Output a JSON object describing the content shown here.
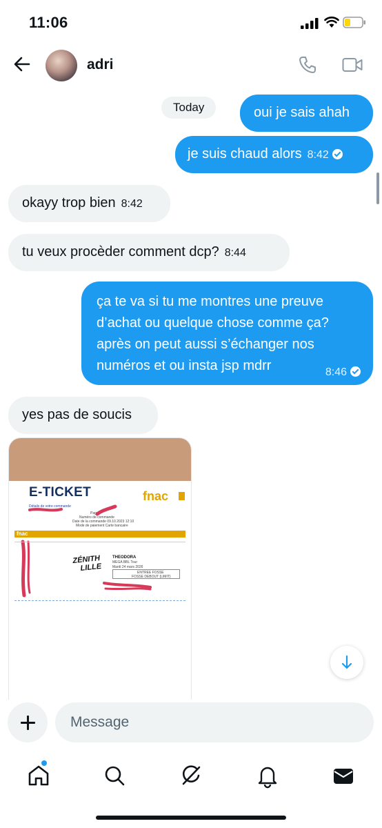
{
  "status_bar": {
    "time": "11:06"
  },
  "header": {
    "contact_name": "adri"
  },
  "chat": {
    "date_label": "Today",
    "messages": [
      {
        "text": "oui je sais ahah",
        "time": ""
      },
      {
        "text": "je suis chaud alors",
        "time": "8:42"
      },
      {
        "text": "okayy trop bien",
        "time": "8:42"
      },
      {
        "text": "tu veux procèder comment dcp?",
        "time": "8:44"
      },
      {
        "lines": [
          "ça te va si tu me montres une preuve",
          "d’achat ou quelque chose comme ça?",
          "après on peut aussi s’échanger nos",
          "numéros et ou insta jsp mdrr"
        ],
        "time": "8:46"
      },
      {
        "text": "yes pas de soucis",
        "time": ""
      }
    ],
    "attachment": {
      "title": "E-TICKET",
      "brand": "fnac",
      "venue": [
        "ZÉNITH",
        "LILLE"
      ],
      "details": [
        "Détails de votre commande",
        "Page",
        "Numéro de commande",
        "Date de la commande  09.10.2023 12:10",
        "Mode de paiement  Carte bancaire"
      ],
      "event": [
        "THEODORA",
        "MEGA BBL Tour",
        "Mardi 24 mars 2026",
        "ENTREE FOSSE",
        "FOSSE DEBOUT (LIMIT)"
      ]
    }
  },
  "composer": {
    "placeholder": "Message"
  },
  "tabs": [
    "home",
    "search",
    "grok",
    "notifications",
    "messages"
  ],
  "colors": {
    "accent": "#1d9bf0",
    "incoming_bubble": "#eff3f4",
    "fnac_yellow": "#e2a500",
    "battery_low": "#ffd60a"
  }
}
